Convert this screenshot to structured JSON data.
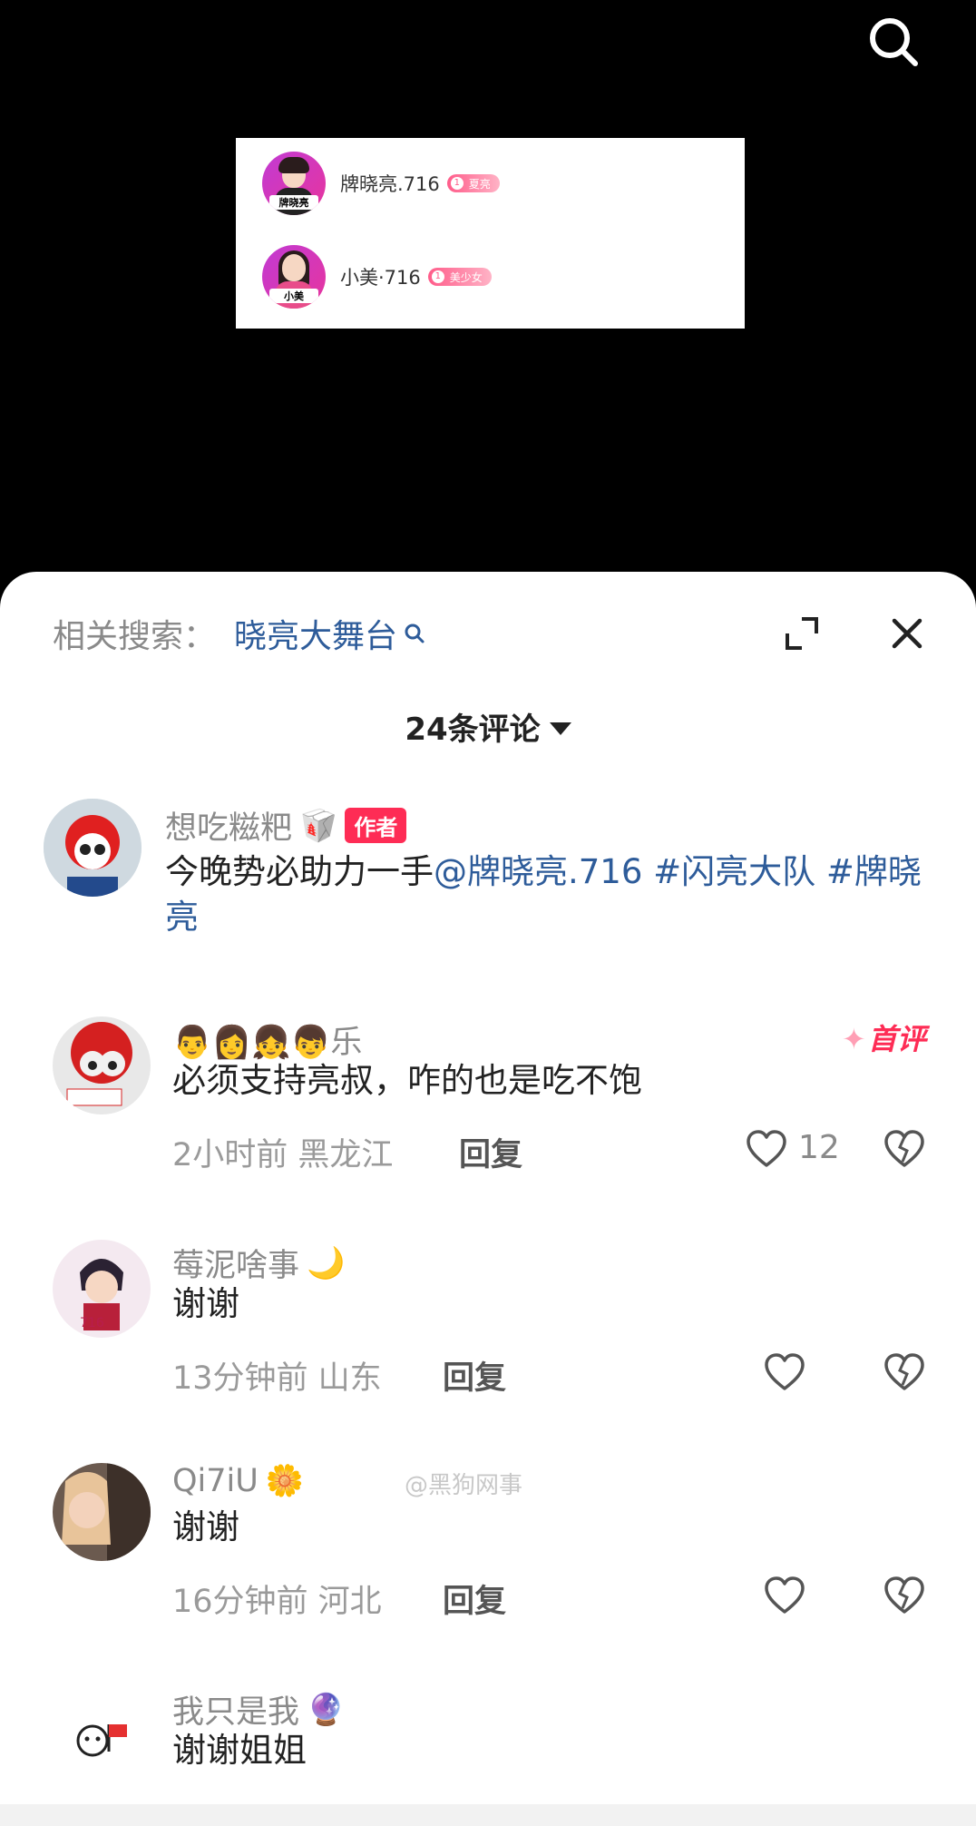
{
  "overlay": {
    "rows": [
      {
        "name": "牌晓亮.716",
        "badge_level": "1",
        "badge_text": "夏亮",
        "avatar_tag": "牌晓亮"
      },
      {
        "name": "小美·716",
        "badge_level": "1",
        "badge_text": "美少女",
        "avatar_tag": "小美"
      }
    ]
  },
  "sheet": {
    "related_label": "相关搜索：",
    "related_link": "晓亮大舞台",
    "count_title": "24条评论"
  },
  "comments": [
    {
      "username": "想吃糍粑",
      "user_emoji": "🥡",
      "author_badge": "作者",
      "text_plain": "今晚势必助力一手",
      "text_mention": "@牌晓亮.716 #闪亮大队 #牌晓亮"
    },
    {
      "username": "👨👩👧👦乐",
      "first_badge": "首评",
      "text": "必须支持亮叔，咋的也是吃不饱",
      "meta": "2小时前 黑龙江",
      "reply": "回复",
      "likes": "12"
    },
    {
      "username": "莓泥啥事",
      "user_emoji": "🌙",
      "text": "谢谢",
      "meta": "13分钟前 山东",
      "reply": "回复"
    },
    {
      "username": "Qi7iU",
      "user_emoji": "🌼",
      "text": "谢谢",
      "meta": "16分钟前 河北",
      "reply": "回复"
    },
    {
      "username": "我只是我",
      "user_emoji": "🔮",
      "text": "谢谢姐姐"
    }
  ],
  "watermark": "@黑狗网事",
  "colors": {
    "accent": "#fe2c55",
    "link": "#2e5c9a"
  }
}
